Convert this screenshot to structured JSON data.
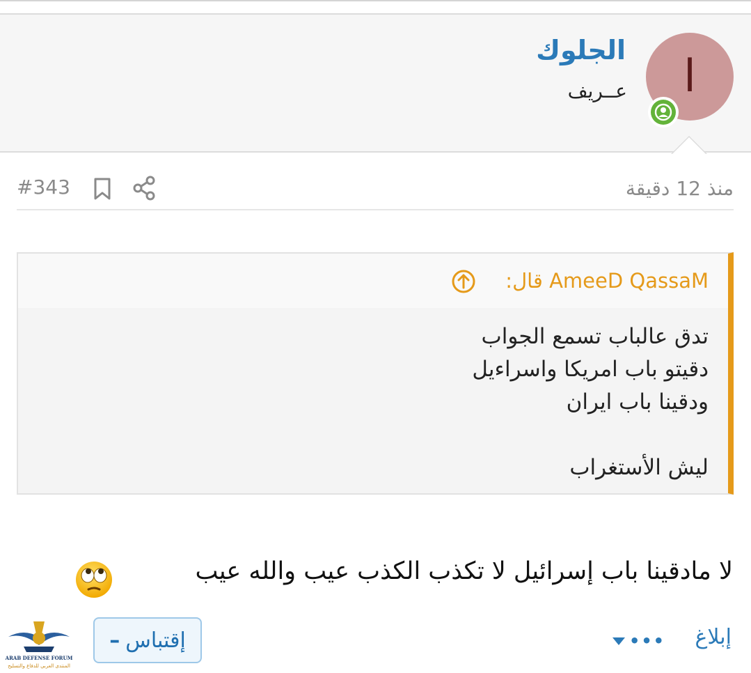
{
  "header": {
    "username": "الجلوك",
    "user_title": "عــريف",
    "avatar_letter": "ا",
    "avatar_color": "#cc9999",
    "status_icon": "user-online-icon"
  },
  "meta": {
    "time": "منذ 12 دقيقة",
    "post_number": "#343",
    "bookmark_icon": "bookmark-icon",
    "share_icon": "share-icon"
  },
  "quote": {
    "author": "AmeeD QassaM قال:",
    "lines": [
      "تدق عالباب تسمع الجواب",
      "دقيتو باب امريكا واسراءيل",
      "ودقينا باب ايران",
      "",
      "ليش الأستغراب"
    ],
    "accent_color": "#e59a1a"
  },
  "message": {
    "text": "لا مادقينا باب إسرائيل لا تكذب الكذب عيب والله عيب",
    "emoji": "eye-roll-emoji"
  },
  "actions": {
    "report_label": "إبلاغ",
    "more_label": "•••",
    "quote_label": "إقتباس",
    "quote_prefix": "–"
  },
  "logo": {
    "text_en": "ARAB DEFENSE FORUM",
    "text_ar": "المنتدى العربي للدفاع والتسليح"
  }
}
